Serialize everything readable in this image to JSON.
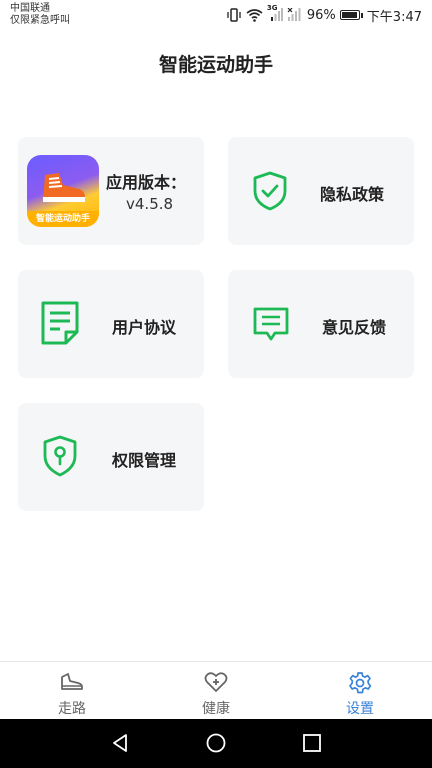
{
  "status_bar": {
    "carrier_line1": "中国联通",
    "carrier_line2": "仅限紧急呼叫",
    "network": "3G",
    "battery": "96%",
    "time": "下午3:47"
  },
  "page": {
    "title": "智能运动助手"
  },
  "cards": {
    "app_version": {
      "label": "应用版本：",
      "value": "v4.5.8",
      "icon_text": "智能运动助手",
      "icon": "app-logo-shoe"
    },
    "privacy": {
      "label": "隐私政策",
      "icon": "shield-check-icon"
    },
    "user_agreement": {
      "label": "用户协议",
      "icon": "document-icon"
    },
    "feedback": {
      "label": "意见反馈",
      "icon": "message-icon"
    },
    "permissions": {
      "label": "权限管理",
      "icon": "shield-key-icon"
    }
  },
  "tabs": [
    {
      "label": "走路",
      "icon": "shoe-icon",
      "active": false
    },
    {
      "label": "健康",
      "icon": "heart-plus-icon",
      "active": false
    },
    {
      "label": "设置",
      "icon": "gear-icon",
      "active": true
    }
  ],
  "colors": {
    "accent_green": "#1db954",
    "tab_active": "#3b82d8",
    "card_bg": "#f5f6f8"
  }
}
